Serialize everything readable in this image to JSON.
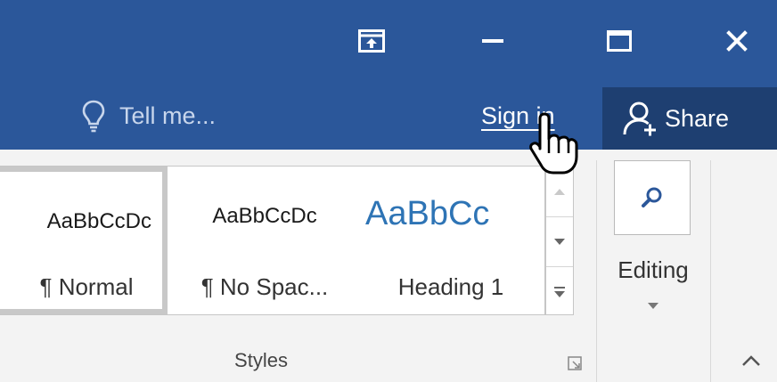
{
  "window": {
    "controls": [
      "ribbon-display-options-icon",
      "minimize-icon",
      "maximize-icon",
      "close-icon"
    ]
  },
  "header": {
    "tell_me": {
      "icon": "lightbulb-icon",
      "placeholder": "Tell me..."
    },
    "sign_in_label": "Sign in",
    "share": {
      "icon": "share-person-icon",
      "label": "Share"
    }
  },
  "ribbon": {
    "styles_group": {
      "label": "Styles",
      "items": [
        {
          "sample": "AaBbCcDc",
          "name": "¶ Normal",
          "selected": true
        },
        {
          "sample": "AaBbCcDc",
          "name": "¶ No Spac...",
          "selected": false
        },
        {
          "sample": "AaBbCc",
          "name": "Heading 1",
          "selected": false,
          "color": "#2e74b5"
        }
      ]
    },
    "editing_group": {
      "label": "Editing",
      "icon": "find-magnifier-icon"
    }
  },
  "colors": {
    "titlebar": "#2b579a",
    "share_bg": "#1e3f71",
    "ribbon_bg": "#f3f3f3",
    "heading_accent": "#2e74b5"
  }
}
